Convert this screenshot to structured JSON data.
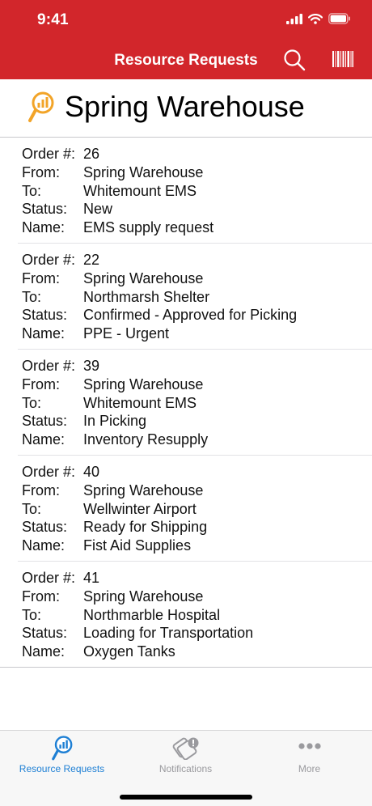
{
  "status_bar": {
    "time": "9:41"
  },
  "nav": {
    "title": "Resource Requests"
  },
  "header": {
    "title": "Spring Warehouse"
  },
  "labels": {
    "order": "Order #:",
    "from": "From:",
    "to": "To:",
    "status": "Status:",
    "name": "Name:"
  },
  "orders": [
    {
      "order": "26",
      "from": "Spring Warehouse",
      "to": "Whitemount EMS",
      "status": "New",
      "name": "EMS supply request"
    },
    {
      "order": "22",
      "from": "Spring Warehouse",
      "to": "Northmarsh Shelter",
      "status": "Confirmed - Approved for Picking",
      "name": "PPE - Urgent"
    },
    {
      "order": "39",
      "from": "Spring Warehouse",
      "to": "Whitemount EMS",
      "status": "In Picking",
      "name": "Inventory Resupply"
    },
    {
      "order": "40",
      "from": "Spring Warehouse",
      "to": "Wellwinter Airport",
      "status": "Ready for Shipping",
      "name": "Fist Aid Supplies"
    },
    {
      "order": "41",
      "from": "Spring Warehouse",
      "to": "Northmarble Hospital",
      "status": "Loading for Transportation",
      "name": "Oxygen Tanks"
    }
  ],
  "tabs": [
    {
      "label": "Resource Requests",
      "icon": "resource-requests-icon",
      "active": true
    },
    {
      "label": "Notifications",
      "icon": "notifications-icon",
      "active": false
    },
    {
      "label": "More",
      "icon": "more-icon",
      "active": false
    }
  ],
  "colors": {
    "brand": "#d2262b",
    "accent": "#1d7fd4",
    "inactive": "#9a9a9e",
    "header_icon": "#f2a428"
  }
}
